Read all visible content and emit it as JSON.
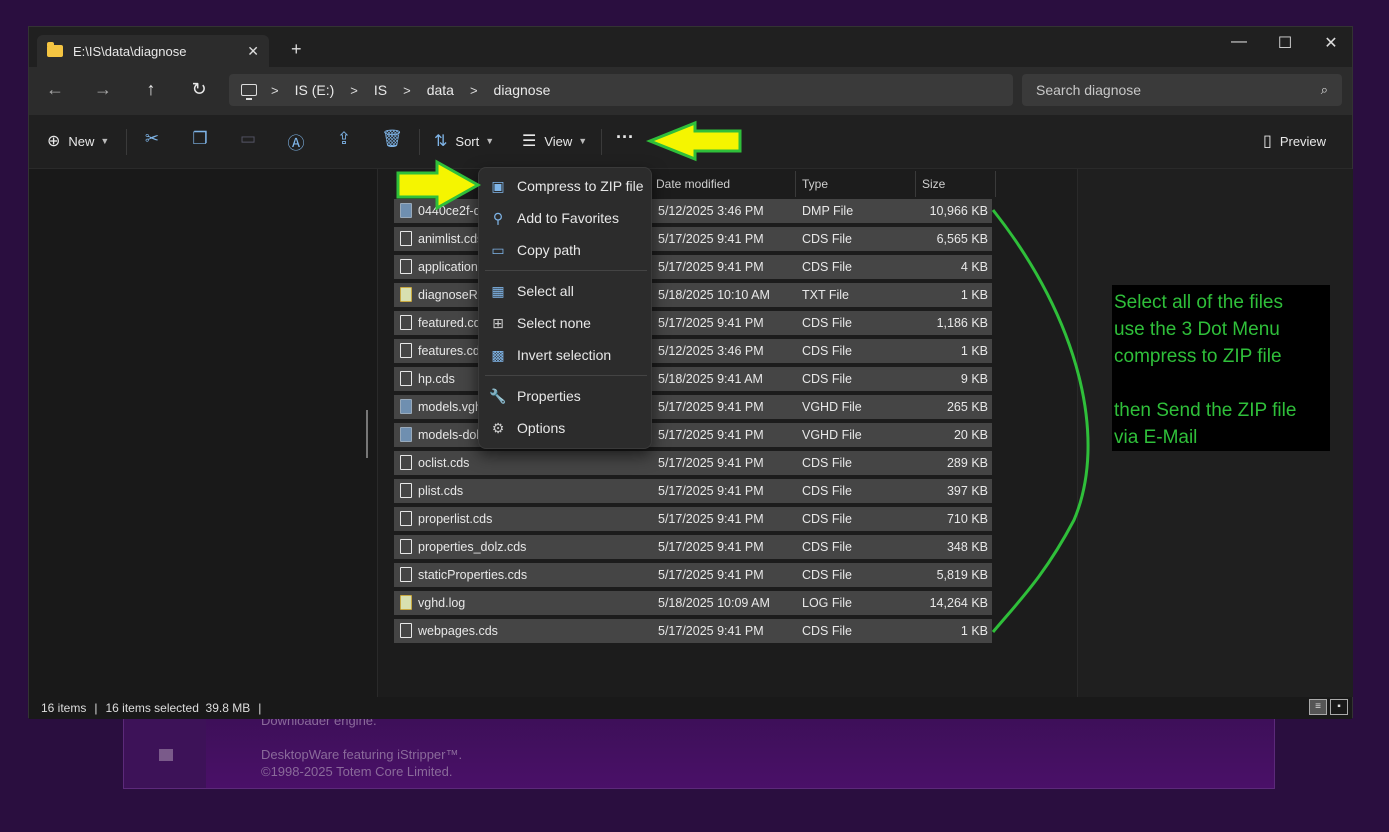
{
  "window": {
    "tab_title": "E:\\IS\\data\\diagnose",
    "tab_close": "✕",
    "new_tab": "+",
    "minimize": "—",
    "maximize": "☐",
    "close": "✕"
  },
  "nav": {
    "back": "←",
    "forward": "→",
    "up": "↑",
    "refresh": "↻",
    "breadcrumb": [
      "IS (E:)",
      "IS",
      "data",
      "diagnose"
    ],
    "search_placeholder": "Search diagnose"
  },
  "toolbar": {
    "new_label": "New",
    "sort_label": "Sort",
    "view_label": "View",
    "more_label": "···",
    "preview_label": "Preview"
  },
  "columns": [
    "Date modified",
    "Type",
    "Size"
  ],
  "files": [
    {
      "name": "0440ce2f-d8",
      "date": "5/12/2025 3:46 PM",
      "type": "DMP File",
      "size": "10,966 KB",
      "icon": "dmp-file-icon"
    },
    {
      "name": "animlist.cds",
      "date": "5/17/2025 9:41 PM",
      "type": "CDS File",
      "size": "6,565 KB",
      "icon": "file-icon"
    },
    {
      "name": "application.",
      "date": "5/17/2025 9:41 PM",
      "type": "CDS File",
      "size": "4 KB",
      "icon": "file-icon"
    },
    {
      "name": "diagnoseRe",
      "date": "5/18/2025 10:10 AM",
      "type": "TXT File",
      "size": "1 KB",
      "icon": "txt-file-icon"
    },
    {
      "name": "featured.cd",
      "date": "5/17/2025 9:41 PM",
      "type": "CDS File",
      "size": "1,186 KB",
      "icon": "file-icon"
    },
    {
      "name": "features.cds",
      "date": "5/12/2025 3:46 PM",
      "type": "CDS File",
      "size": "1 KB",
      "icon": "file-icon"
    },
    {
      "name": "hp.cds",
      "date": "5/18/2025 9:41 AM",
      "type": "CDS File",
      "size": "9 KB",
      "icon": "file-icon"
    },
    {
      "name": "models.vgh",
      "date": "5/17/2025 9:41 PM",
      "type": "VGHD File",
      "size": "265 KB",
      "icon": "vghd-file-icon"
    },
    {
      "name": "models-dol",
      "date": "5/17/2025 9:41 PM",
      "type": "VGHD File",
      "size": "20 KB",
      "icon": "vghd-file-icon"
    },
    {
      "name": "oclist.cds",
      "date": "5/17/2025 9:41 PM",
      "type": "CDS File",
      "size": "289 KB",
      "icon": "file-icon"
    },
    {
      "name": "plist.cds",
      "date": "5/17/2025 9:41 PM",
      "type": "CDS File",
      "size": "397 KB",
      "icon": "file-icon"
    },
    {
      "name": "properlist.cds",
      "date": "5/17/2025 9:41 PM",
      "type": "CDS File",
      "size": "710 KB",
      "icon": "file-icon"
    },
    {
      "name": "properties_dolz.cds",
      "date": "5/17/2025 9:41 PM",
      "type": "CDS File",
      "size": "348 KB",
      "icon": "file-icon"
    },
    {
      "name": "staticProperties.cds",
      "date": "5/17/2025 9:41 PM",
      "type": "CDS File",
      "size": "5,819 KB",
      "icon": "file-icon"
    },
    {
      "name": "vghd.log",
      "date": "5/18/2025 10:09 AM",
      "type": "LOG File",
      "size": "14,264 KB",
      "icon": "txt-file-icon"
    },
    {
      "name": "webpages.cds",
      "date": "5/17/2025 9:41 PM",
      "type": "CDS File",
      "size": "1 KB",
      "icon": "file-icon"
    }
  ],
  "menu": {
    "compress": "Compress to ZIP file",
    "favorites": "Add to Favorites",
    "copy_path": "Copy path",
    "select_all": "Select all",
    "select_none": "Select none",
    "invert": "Invert selection",
    "properties": "Properties",
    "options": "Options"
  },
  "status": {
    "items": "16 items",
    "selected": "16 items selected  39.8 MB"
  },
  "annotation": {
    "text": "Select all of the files\nuse the 3 Dot Menu\ncompress to ZIP file\n\nthen Send the ZIP file\nvia E-Mail",
    "arrow_color": "#f5f500",
    "arrow_outline": "#2fbf3a",
    "text_color": "#2fbf3a"
  },
  "background_app": {
    "line1": "Downloader engine.",
    "line2": "DesktopWare featuring iStripper™.",
    "line3": "©1998-2025 Totem Core Limited."
  }
}
